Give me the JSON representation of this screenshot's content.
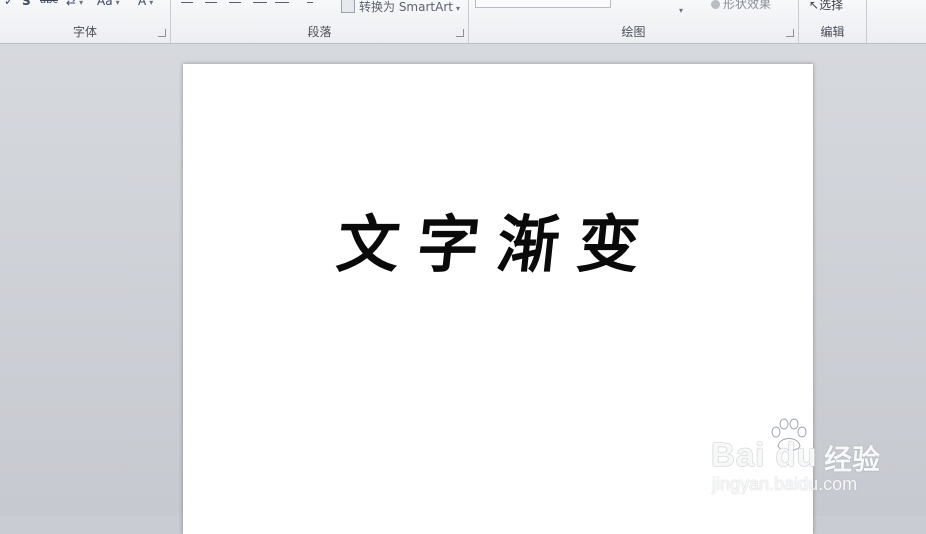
{
  "ribbon": {
    "groups": {
      "font": {
        "label": "字体"
      },
      "paragraph": {
        "label": "段落",
        "smartart_label": "转换为 SmartArt"
      },
      "drawing": {
        "label": "绘图",
        "shape_effects_label": "形状效果"
      },
      "editing": {
        "label": "编辑",
        "select_label": "选择"
      }
    },
    "font_tools": {
      "bold_shadow": "S",
      "strike": "abc",
      "case": "Aa",
      "font_color": "A"
    },
    "icons": [
      "shadow-icon",
      "strikethrough-icon",
      "character-spacing-icon",
      "change-case-icon",
      "font-color-icon",
      "align-left-icon",
      "align-center-icon",
      "align-right-icon",
      "justify-icon",
      "distribute-icon",
      "columns-icon",
      "smartart-icon",
      "shape-gallery-icon",
      "shape-effects-icon",
      "select-icon",
      "dialog-launcher-icon"
    ]
  },
  "document": {
    "heading": "文字渐变"
  },
  "watermark": {
    "logo": "Bai du",
    "brand": "经验",
    "url": "jingyan.baidu.com"
  }
}
